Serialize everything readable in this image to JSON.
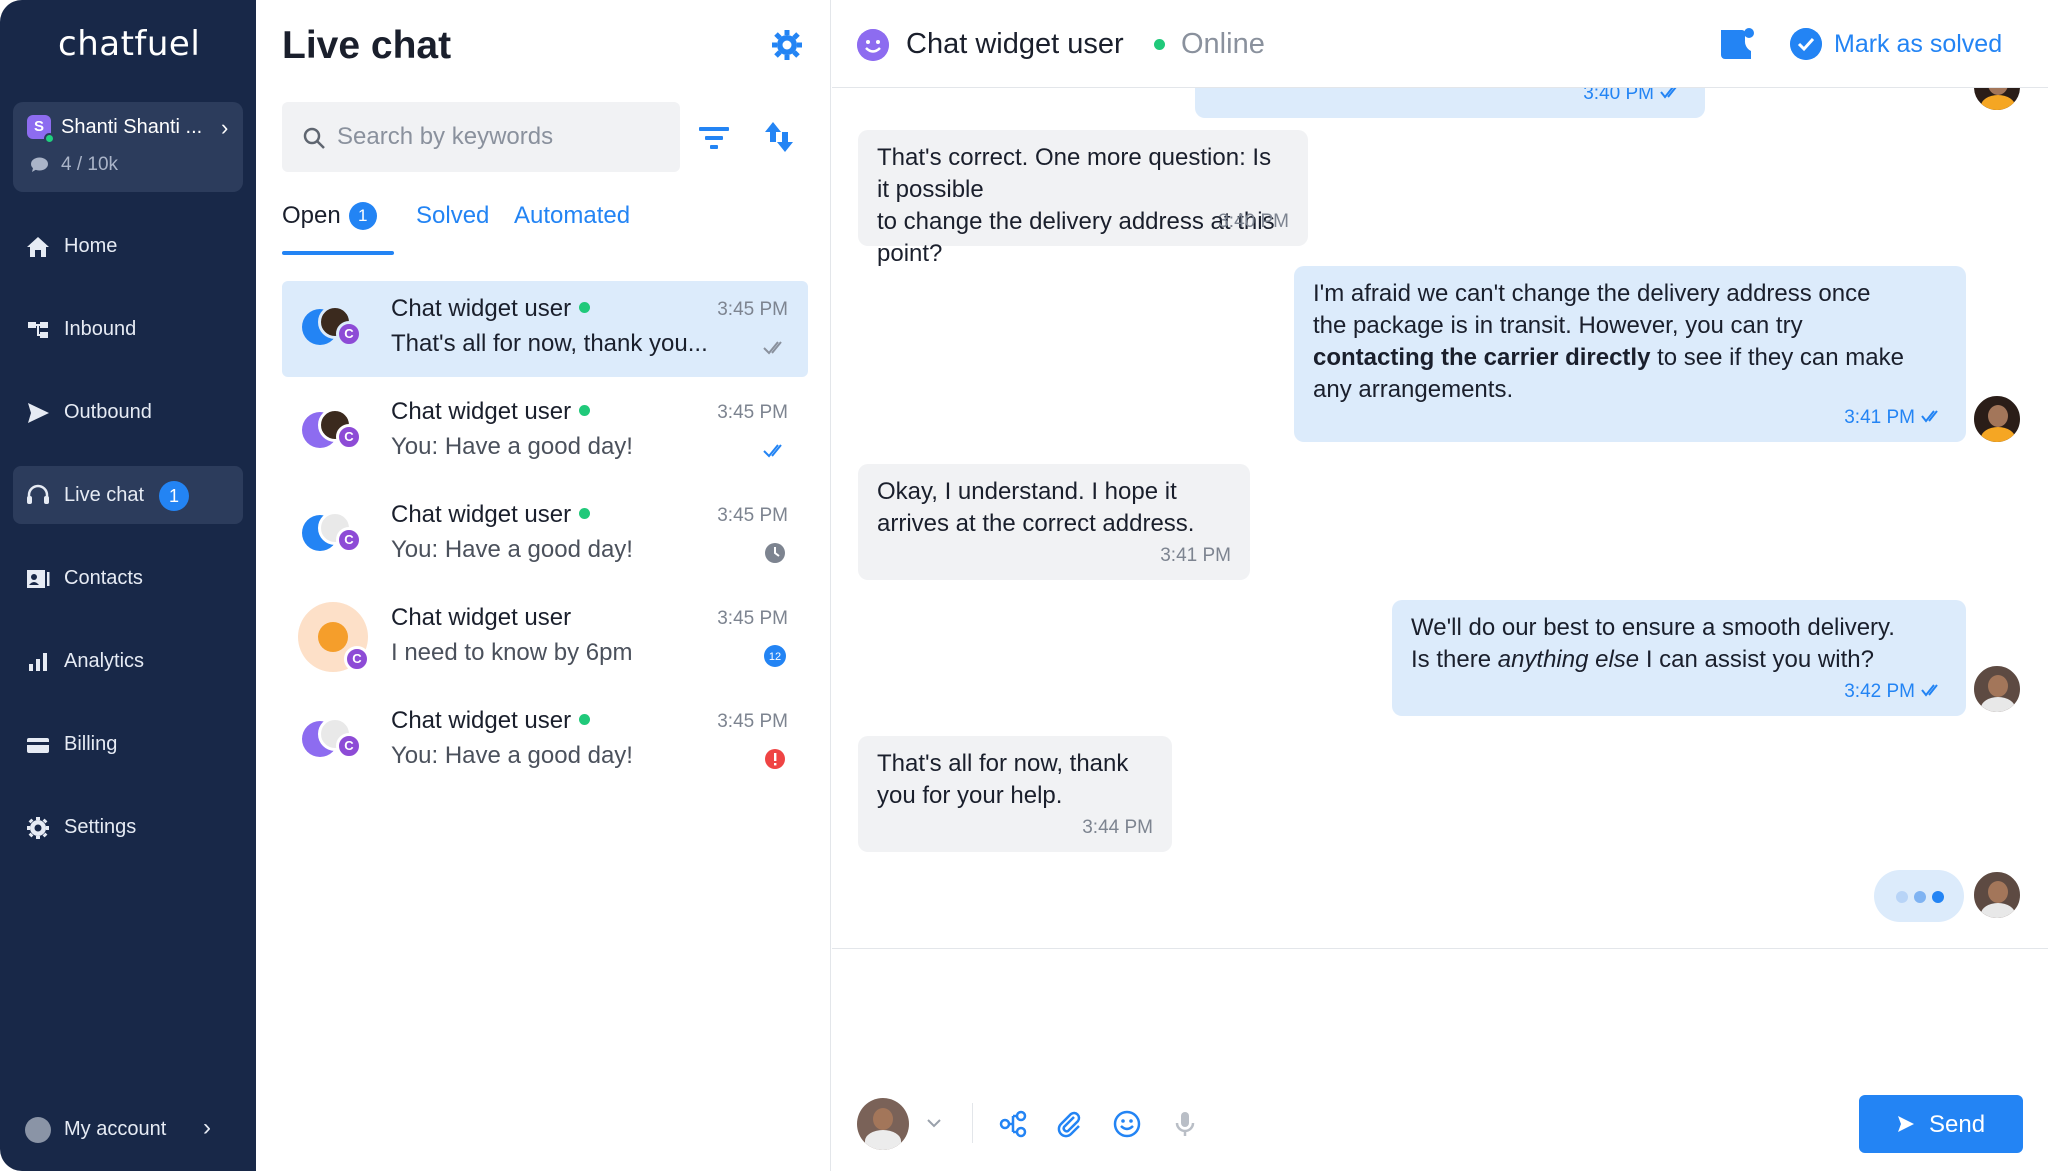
{
  "sidebar": {
    "logo": "chatfuel",
    "workspace": {
      "initial": "S",
      "name": "Shanti Shanti ...",
      "usage": "4 / 10k"
    },
    "nav": [
      {
        "label": "Home",
        "icon": "home-icon"
      },
      {
        "label": "Inbound",
        "icon": "inbound-icon"
      },
      {
        "label": "Outbound",
        "icon": "outbound-icon"
      },
      {
        "label": "Live chat",
        "icon": "headset-icon",
        "badge": "1",
        "active": true
      },
      {
        "label": "Contacts",
        "icon": "contacts-icon"
      },
      {
        "label": "Analytics",
        "icon": "analytics-icon"
      },
      {
        "label": "Billing",
        "icon": "billing-icon"
      },
      {
        "label": "Settings",
        "icon": "gear-icon"
      }
    ],
    "my_account": "My account"
  },
  "list": {
    "title": "Live chat",
    "search_placeholder": "Search by keywords",
    "tabs": {
      "open": "Open",
      "open_count": "1",
      "solved": "Solved",
      "automated": "Automated"
    },
    "conversations": [
      {
        "name": "Chat widget user",
        "online": true,
        "time": "3:45 PM",
        "preview": "That's all for now, thank you...",
        "status": "read",
        "selected": true
      },
      {
        "name": "Chat widget user",
        "online": true,
        "time": "3:45 PM",
        "preview": "You: Have a good day!",
        "status": "delivered"
      },
      {
        "name": "Chat widget user",
        "online": true,
        "time": "3:45 PM",
        "preview": "You: Have a good day!",
        "status": "pending"
      },
      {
        "name": "Chat widget user",
        "online": false,
        "time": "3:45 PM",
        "preview": "I need to know by 6pm",
        "status": "unread",
        "unread_count": "12"
      },
      {
        "name": "Chat widget user",
        "online": true,
        "time": "3:45 PM",
        "preview": "You: Have a good day!",
        "status": "error"
      }
    ]
  },
  "chat": {
    "header": {
      "name": "Chat widget user",
      "status": "Online",
      "mark_solved": "Mark as solved"
    },
    "messages": [
      {
        "dir": "out",
        "partial_time": "3:40 PM"
      },
      {
        "dir": "in",
        "lines": [
          "That's correct. One more question: Is it possible",
          "to change the delivery address at this point?"
        ],
        "time": "3:40 PM"
      },
      {
        "dir": "out",
        "line1": "I'm afraid we can't change the delivery address once",
        "line2": "the package is in transit. However, you can try",
        "bold": "contacting the carrier directly",
        "line3_rest": " to see if they can make",
        "line4": "any arrangements.",
        "time": "3:41 PM"
      },
      {
        "dir": "in",
        "lines": [
          "Okay, I understand. I hope it",
          "arrives at the correct address."
        ],
        "time": "3:41 PM"
      },
      {
        "dir": "out",
        "line1": "We'll do our best to ensure a smooth delivery.",
        "line2_pre": "Is there ",
        "italic": "anything else",
        "line2_post": " I can assist you with?",
        "time": "3:42 PM"
      },
      {
        "dir": "in",
        "lines": [
          "That's all for now, thank",
          "you for your help."
        ],
        "time": "3:44 PM"
      }
    ],
    "composer": {
      "placeholder": "",
      "send": "Send"
    }
  },
  "colors": {
    "sidebar": "#182848",
    "accent": "#2384f4",
    "online": "#20c97a",
    "outgoing_bubble": "#dcebfb",
    "incoming_bubble": "#f1f2f4",
    "error": "#ef4444"
  }
}
